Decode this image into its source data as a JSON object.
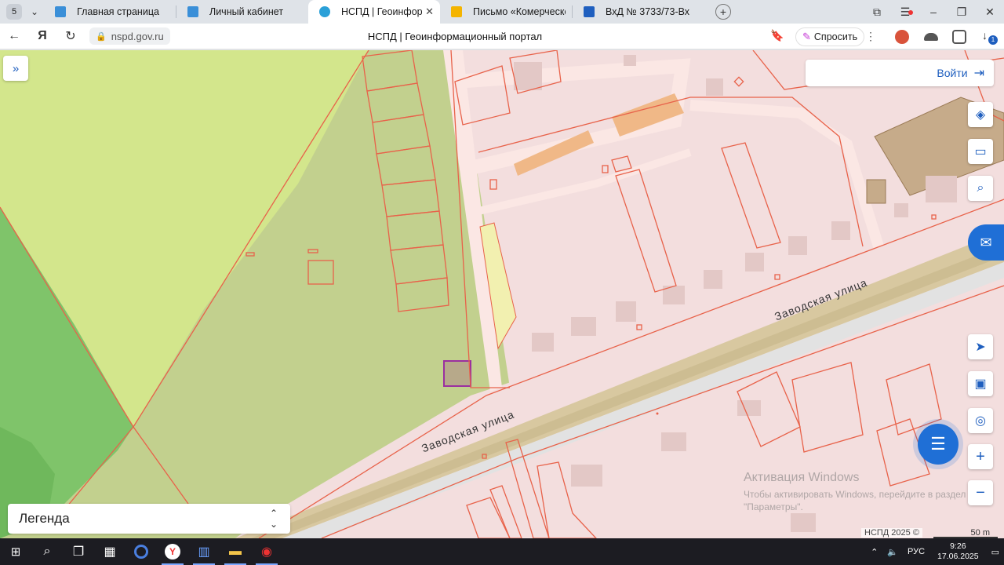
{
  "browser": {
    "tab_count": "5",
    "tabs": [
      {
        "label": "Главная страница",
        "active": false,
        "favicon_color": "#3a8fd8"
      },
      {
        "label": "Личный кабинет",
        "active": false,
        "favicon_color": "#3a8fd8"
      },
      {
        "label": "НСПД | Геоинформаци",
        "active": true,
        "favicon_color": "#2aa0d8"
      },
      {
        "label": "Письмо «Комерческое пр",
        "active": false,
        "favicon_color": "#f4b400"
      },
      {
        "label": "ВхД № 3733/73-Вх",
        "active": false,
        "favicon_color": "#1f5fbf"
      }
    ],
    "url": "nspd.gov.ru",
    "page_title": "НСПД | Геоинформационный портал",
    "ask_label": "Спросить",
    "download_badge": "1"
  },
  "map": {
    "login_label": "Войти",
    "legend_label": "Легенда",
    "street_name_1": "Заводская улица",
    "street_name_2": "Заводская улица",
    "attribution": "НСПД 2025 ©",
    "scale_label": "50 m",
    "colors": {
      "parcel_outline": "#e8624a",
      "background_green": "#c2d08e",
      "light_green": "#d3e68c",
      "forest_green": "#7fc46a",
      "urban_pink": "#f3dede",
      "road": "#d8c8a0",
      "building_orange": "#f0b887",
      "accent_blue": "#1f6fd6"
    }
  },
  "watermark": {
    "line1": "Активация Windows",
    "line2": "Чтобы активировать Windows, перейдите в раздел",
    "line3": "\"Параметры\"."
  },
  "taskbar": {
    "lang": "РУС",
    "time": "9:26",
    "date": "17.06.2025"
  }
}
